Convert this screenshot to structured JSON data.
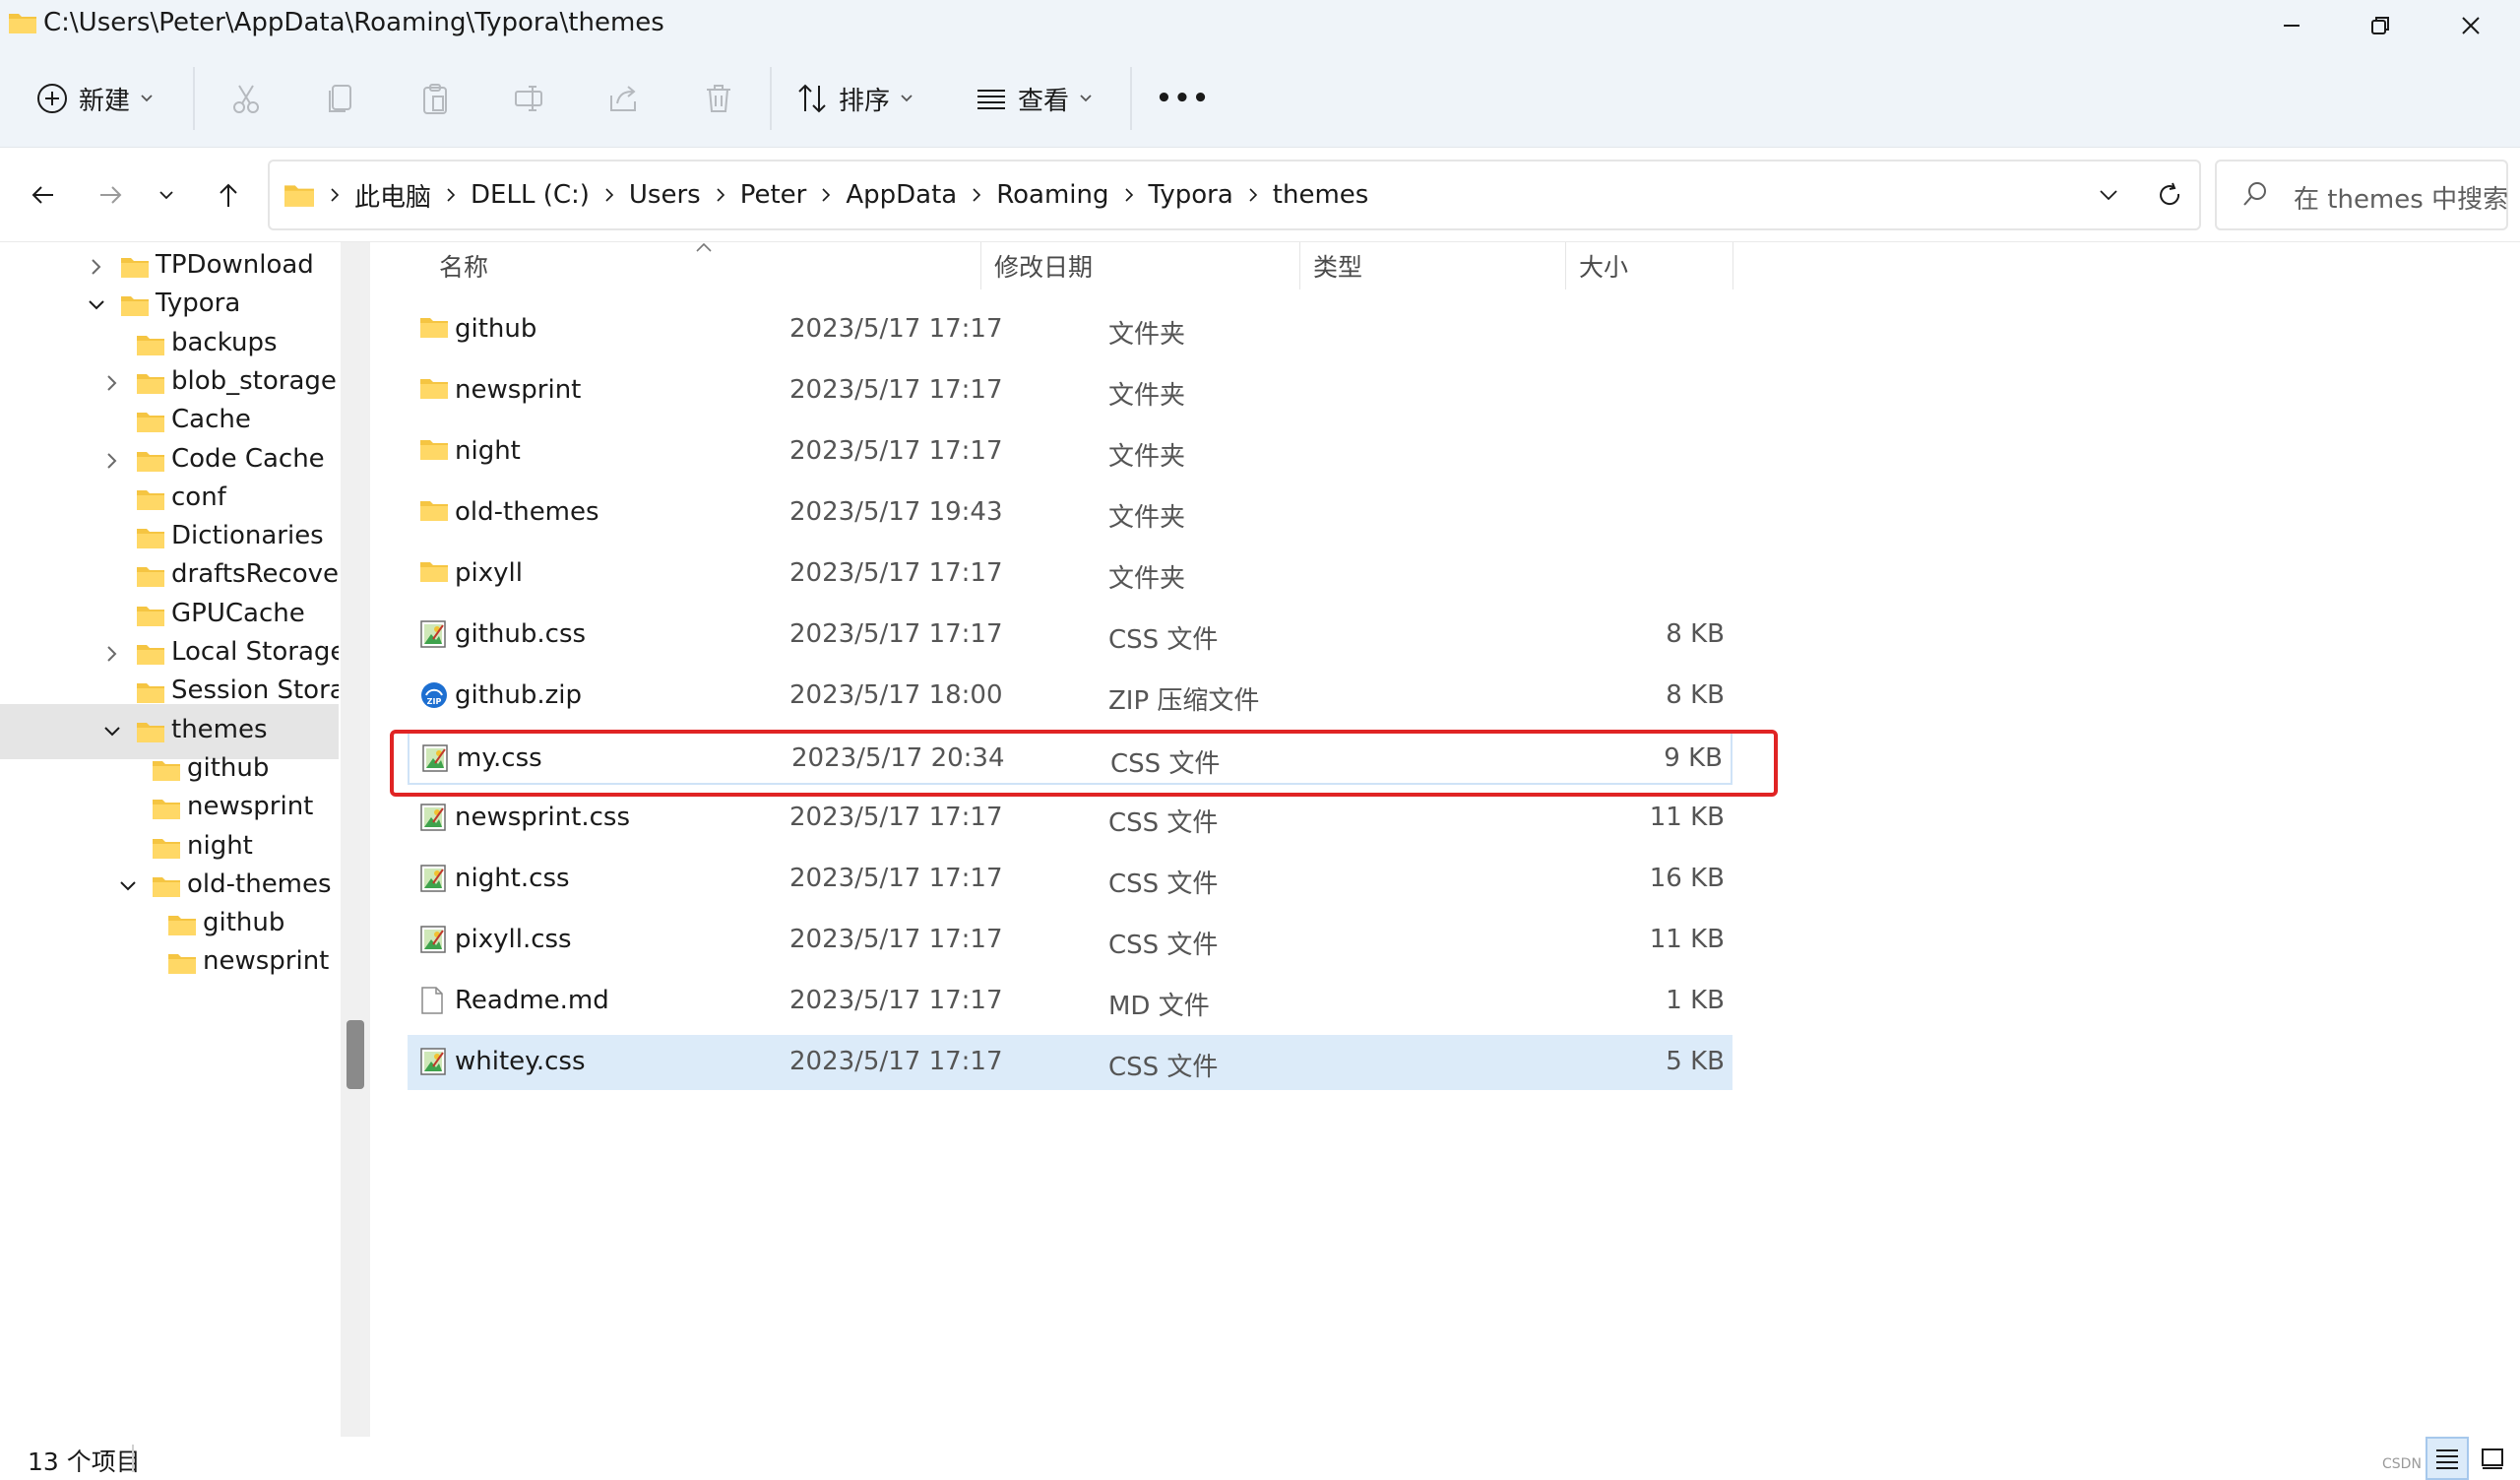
{
  "window": {
    "title": "C:\\Users\\Peter\\AppData\\Roaming\\Typora\\themes"
  },
  "toolbar": {
    "new_label": "新建",
    "sort_label": "排序",
    "view_label": "查看",
    "more_label": "•••"
  },
  "address": {
    "crumbs": [
      "此电脑",
      "DELL (C:)",
      "Users",
      "Peter",
      "AppData",
      "Roaming",
      "Typora",
      "themes"
    ]
  },
  "search": {
    "placeholder": "在 themes 中搜索"
  },
  "nav_tree": [
    {
      "label": "TPDownload",
      "expanded": false,
      "has_children": true
    },
    {
      "label": "Typora",
      "expanded": true,
      "has_children": true
    },
    {
      "label": "backups",
      "has_children": false
    },
    {
      "label": "blob_storage",
      "expanded": false,
      "has_children": true
    },
    {
      "label": "Cache",
      "has_children": false
    },
    {
      "label": "Code Cache",
      "expanded": false,
      "has_children": true
    },
    {
      "label": "conf",
      "has_children": false
    },
    {
      "label": "Dictionaries",
      "has_children": false
    },
    {
      "label": "draftsRecover",
      "has_children": false
    },
    {
      "label": "GPUCache",
      "has_children": false
    },
    {
      "label": "Local Storage",
      "expanded": false,
      "has_children": true
    },
    {
      "label": "Session Storage",
      "has_children": false
    },
    {
      "label": "themes",
      "expanded": true,
      "has_children": true,
      "selected": true
    },
    {
      "label": "github",
      "has_children": false
    },
    {
      "label": "newsprint",
      "has_children": false
    },
    {
      "label": "night",
      "has_children": false
    },
    {
      "label": "old-themes",
      "expanded": true,
      "has_children": true
    },
    {
      "label": "github",
      "has_children": false
    },
    {
      "label": "newsprint",
      "has_children": false
    }
  ],
  "columns": {
    "name": "名称",
    "date": "修改日期",
    "type": "类型",
    "size": "大小"
  },
  "files": [
    {
      "name": "github",
      "date": "2023/5/17 17:17",
      "type": "文件夹",
      "size": "",
      "icon": "folder-icon"
    },
    {
      "name": "newsprint",
      "date": "2023/5/17 17:17",
      "type": "文件夹",
      "size": "",
      "icon": "folder-icon"
    },
    {
      "name": "night",
      "date": "2023/5/17 17:17",
      "type": "文件夹",
      "size": "",
      "icon": "folder-icon"
    },
    {
      "name": "old-themes",
      "date": "2023/5/17 19:43",
      "type": "文件夹",
      "size": "",
      "icon": "folder-icon"
    },
    {
      "name": "pixyll",
      "date": "2023/5/17 17:17",
      "type": "文件夹",
      "size": "",
      "icon": "folder-icon"
    },
    {
      "name": "github.css",
      "date": "2023/5/17 17:17",
      "type": "CSS 文件",
      "size": "8 KB",
      "icon": "css-file-icon"
    },
    {
      "name": "github.zip",
      "date": "2023/5/17 18:00",
      "type": "ZIP 压缩文件",
      "size": "8 KB",
      "icon": "zip-file-icon"
    },
    {
      "name": "my.css",
      "date": "2023/5/17 20:34",
      "type": "CSS 文件",
      "size": "9 KB",
      "icon": "css-file-icon",
      "focused": true
    },
    {
      "name": "newsprint.css",
      "date": "2023/5/17 17:17",
      "type": "CSS 文件",
      "size": "11 KB",
      "icon": "css-file-icon"
    },
    {
      "name": "night.css",
      "date": "2023/5/17 17:17",
      "type": "CSS 文件",
      "size": "16 KB",
      "icon": "css-file-icon"
    },
    {
      "name": "pixyll.css",
      "date": "2023/5/17 17:17",
      "type": "CSS 文件",
      "size": "11 KB",
      "icon": "css-file-icon"
    },
    {
      "name": "Readme.md",
      "date": "2023/5/17 17:17",
      "type": "MD 文件",
      "size": "1 KB",
      "icon": "md-file-icon"
    },
    {
      "name": "whitey.css",
      "date": "2023/5/17 17:17",
      "type": "CSS 文件",
      "size": "5 KB",
      "icon": "css-file-icon",
      "selected": true
    }
  ],
  "status": {
    "count": "13 个项目",
    "watermark": "CSDN @"
  },
  "colors": {
    "chrome_bg": "#eff4f9",
    "selection": "#dcebf9",
    "highlight": "#e02424",
    "folder": "#f5c542"
  }
}
